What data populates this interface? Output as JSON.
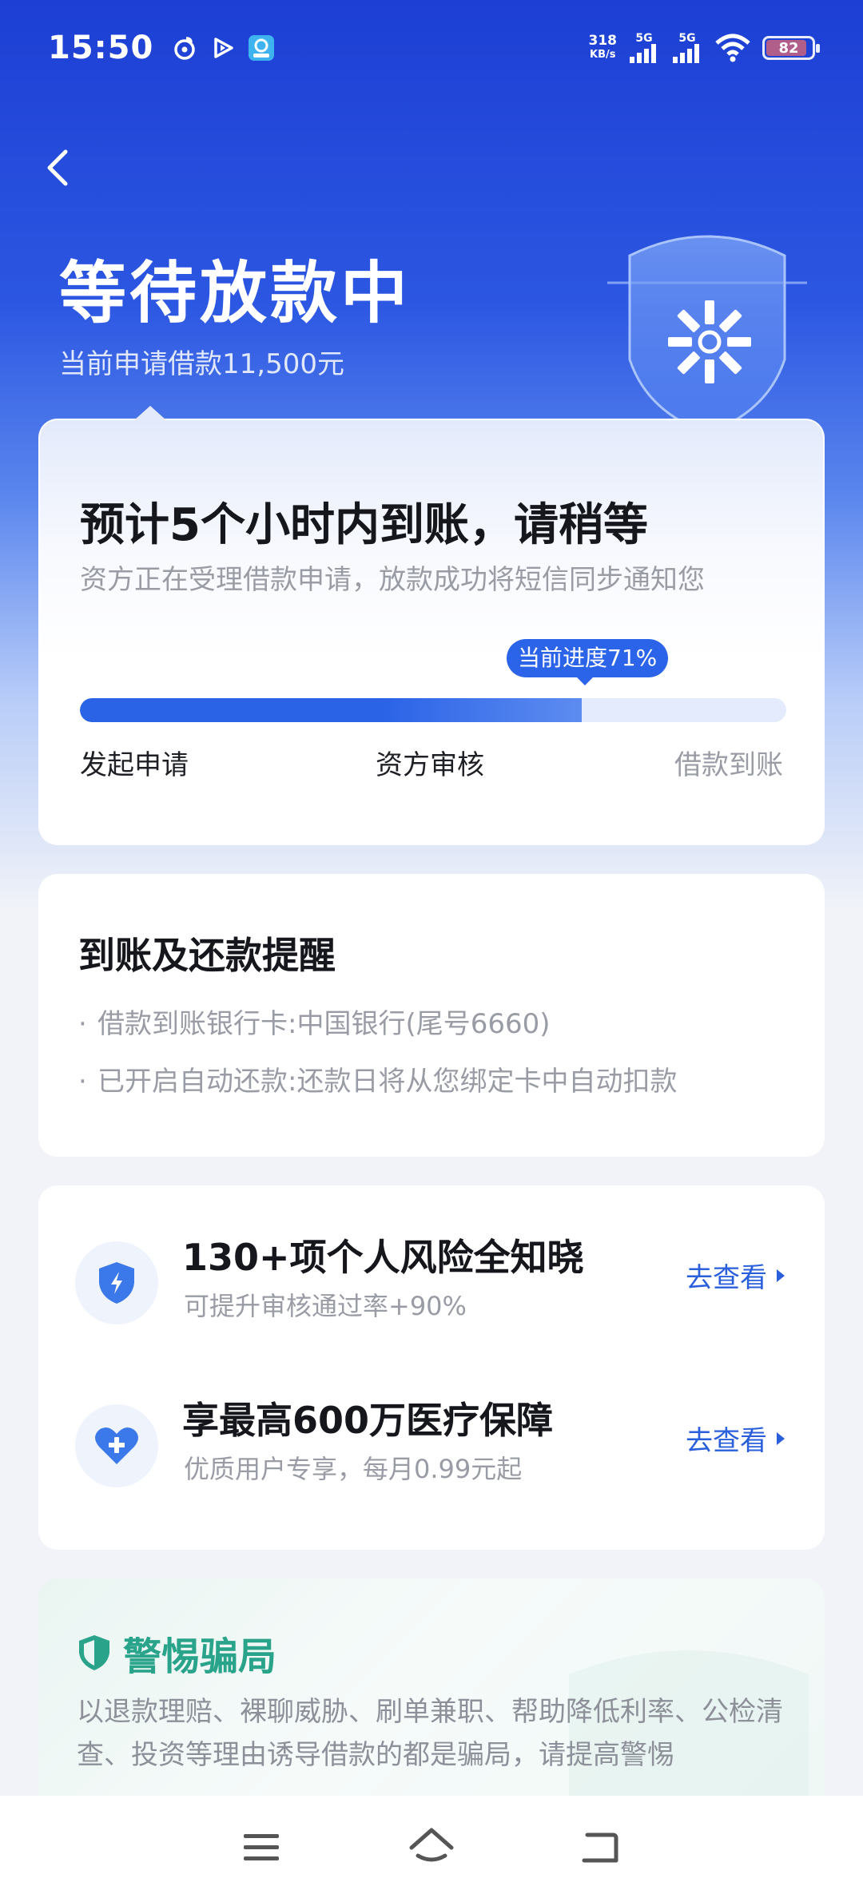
{
  "status_bar": {
    "time": "15:50",
    "net_speed_value": "318",
    "net_speed_unit": "KB/s",
    "signal1_tag": "5G",
    "signal2_tag": "5G",
    "battery": "82"
  },
  "header": {
    "title": "等待放款中",
    "subtitle": "当前申请借款11,500元"
  },
  "progress_card": {
    "title": "预计5个小时内到账，请稍等",
    "description": "资方正在受理借款申请，放款成功将短信同步通知您",
    "badge": "当前进度71%",
    "progress_fraction": 0.71,
    "steps": [
      "发起申请",
      "资方审核",
      "借款到账"
    ]
  },
  "reminder_card": {
    "title": "到账及还款提醒",
    "items": [
      "借款到账银行卡:中国银行(尾号6660)",
      "已开启自动还款:还款日将从您绑定卡中自动扣款"
    ]
  },
  "services": [
    {
      "title": "130+项个人风险全知晓",
      "subtitle": "可提升审核通过率+90%",
      "link": "去查看",
      "icon": "shield-lightning-icon"
    },
    {
      "title": "享最高600万医疗保障",
      "subtitle": "优质用户专享，每月0.99元起",
      "link": "去查看",
      "icon": "heart-plus-icon"
    }
  ],
  "warning_card": {
    "title": "警惕骗局",
    "text": "以退款理赔、裸聊威胁、刷单兼职、帮助降低利率、公检清查、投资等理由诱导借款的都是骗局，请提高警惕"
  },
  "colors": {
    "primary": "#2b63e7",
    "hero_top": "#1d3fd4",
    "warning_green": "#29a48a",
    "link": "#2a5fdc"
  }
}
